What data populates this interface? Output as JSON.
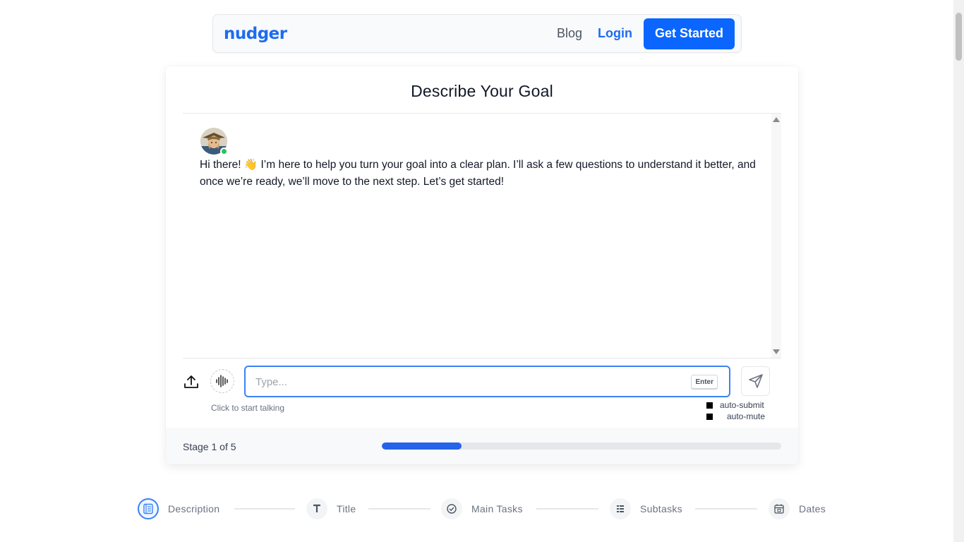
{
  "header": {
    "logo": "nudger",
    "blog": "Blog",
    "login": "Login",
    "cta": "Get Started"
  },
  "card": {
    "title": "Describe Your Goal",
    "message": "Hi there! 👋 I’m here to help you turn your goal into a clear plan. I’ll ask a few questions to understand it better, and once we’re ready, we’ll move to the next step. Let’s get started!",
    "mic_hint": "Click to start talking",
    "input": {
      "placeholder": "Type...",
      "value": ""
    },
    "enter_key": "Enter",
    "options": {
      "auto_submit": "auto-submit",
      "auto_mute": "auto-mute"
    },
    "stage_text": "Stage 1 of 5",
    "progress_fraction": 0.2
  },
  "steps": [
    {
      "label": "Description",
      "icon": "document-icon",
      "active": true
    },
    {
      "label": "Title",
      "icon": "text-t-icon",
      "active": false
    },
    {
      "label": "Main Tasks",
      "icon": "check-circle-icon",
      "active": false
    },
    {
      "label": "Subtasks",
      "icon": "list-icon",
      "active": false
    },
    {
      "label": "Dates",
      "icon": "calendar-icon",
      "active": false
    }
  ],
  "colors": {
    "brand": "#1d6cf0",
    "cta": "#0a66ff",
    "progress": "#2563eb",
    "online": "#22c55e"
  }
}
